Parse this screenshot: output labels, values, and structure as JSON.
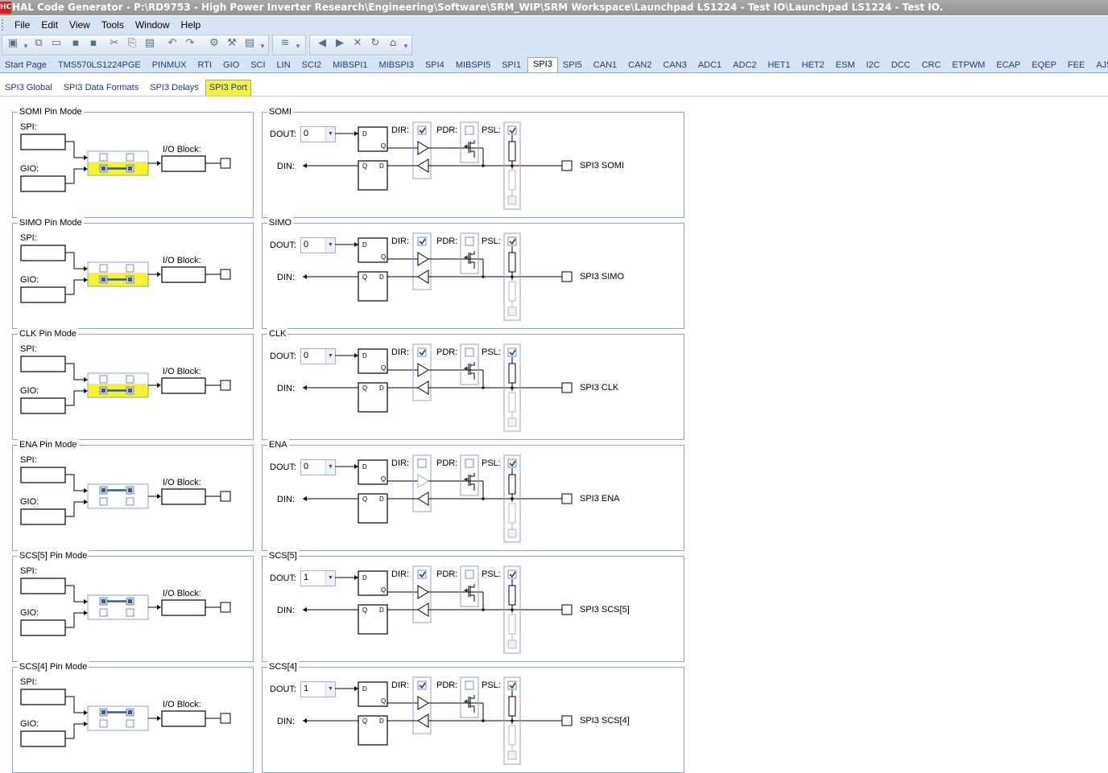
{
  "window": {
    "title": "HAL Code Generator - P:\\RD9753 - High Power Inverter Research\\Engineering\\Software\\SRM_WIP\\SRM Workspace\\Launchpad LS1224 - Test IO\\Launchpad LS1224 - Test IO.",
    "app_icon": "HC"
  },
  "menu": [
    "File",
    "Edit",
    "View",
    "Tools",
    "Window",
    "Help"
  ],
  "toolbar_icons": [
    "new-project-icon",
    "dropdown-arrow-icon",
    "open-icon",
    "open-folder-icon",
    "save-icon",
    "save-all-icon",
    "cut-icon",
    "copy-icon",
    "paste-icon",
    "undo-icon",
    "redo-icon",
    "generate-code-icon",
    "settings-icon",
    "report-icon",
    "toolbar-overflow-icon",
    "layers-icon",
    "toolbar-overflow-icon",
    "back-icon",
    "forward-icon",
    "stop-icon",
    "refresh-icon",
    "home-icon",
    "toolbar-overflow-icon"
  ],
  "main_tabs": [
    "Start Page",
    "TMS570LS1224PGE",
    "PINMUX",
    "RTI",
    "GIO",
    "SCI",
    "LIN",
    "SCI2",
    "MIBSPI1",
    "MIBSPI3",
    "SPI4",
    "MIBSPI5",
    "SPI1",
    "SPI3",
    "SPI5",
    "CAN1",
    "CAN2",
    "CAN3",
    "ADC1",
    "ADC2",
    "HET1",
    "HET2",
    "ESM",
    "I2C",
    "DCC",
    "CRC",
    "ETPWM",
    "ECAP",
    "EQEP",
    "FEE",
    "AJSM"
  ],
  "active_main_tab": "SPI3",
  "sub_tabs": [
    "SPI3 Global",
    "SPI3 Data Formats",
    "SPI3 Delays",
    "SPI3 Port"
  ],
  "active_sub_tab": "SPI3 Port",
  "labels": {
    "spi": "SPI:",
    "gio": "GIO:",
    "io_block": "I/O Block:",
    "dout": "DOUT:",
    "din": "DIN:",
    "dir": "DIR:",
    "pdr": "PDR:",
    "psl": "PSL:",
    "d": "D",
    "q": "Q"
  },
  "pins": [
    {
      "mode_title": "SOMI Pin Mode",
      "port_title": "SOMI",
      "dout": "0",
      "dir": true,
      "pdr": false,
      "psl": true,
      "pin_name": "SPI3 SOMI",
      "gio_selected": true,
      "highlighted": true
    },
    {
      "mode_title": "SIMO Pin Mode",
      "port_title": "SIMO",
      "dout": "0",
      "dir": true,
      "pdr": false,
      "psl": true,
      "pin_name": "SPI3 SIMO",
      "gio_selected": true,
      "highlighted": true
    },
    {
      "mode_title": "CLK Pin Mode",
      "port_title": "CLK",
      "dout": "0",
      "dir": true,
      "pdr": false,
      "psl": true,
      "pin_name": "SPI3 CLK",
      "gio_selected": true,
      "highlighted": true
    },
    {
      "mode_title": "ENA Pin Mode",
      "port_title": "ENA",
      "dout": "0",
      "dir": false,
      "pdr": false,
      "psl": true,
      "pin_name": "SPI3 ENA",
      "gio_selected": false,
      "highlighted": false
    },
    {
      "mode_title": "SCS[5] Pin Mode",
      "port_title": "SCS[5]",
      "dout": "1",
      "dir": true,
      "pdr": false,
      "psl": true,
      "pin_name": "SPI3 SCS[5]",
      "gio_selected": false,
      "highlighted": false
    },
    {
      "mode_title": "SCS[4] Pin Mode",
      "port_title": "SCS[4]",
      "dout": "1",
      "dir": true,
      "pdr": false,
      "psl": true,
      "pin_name": "SPI3 SCS[4]",
      "gio_selected": false,
      "highlighted": false
    }
  ],
  "colors": {
    "menu_bg": "#d7e4f5",
    "highlight": "#f5f233",
    "panel_border": "#8aa4c6",
    "title_bar": "#9c9c9c"
  }
}
